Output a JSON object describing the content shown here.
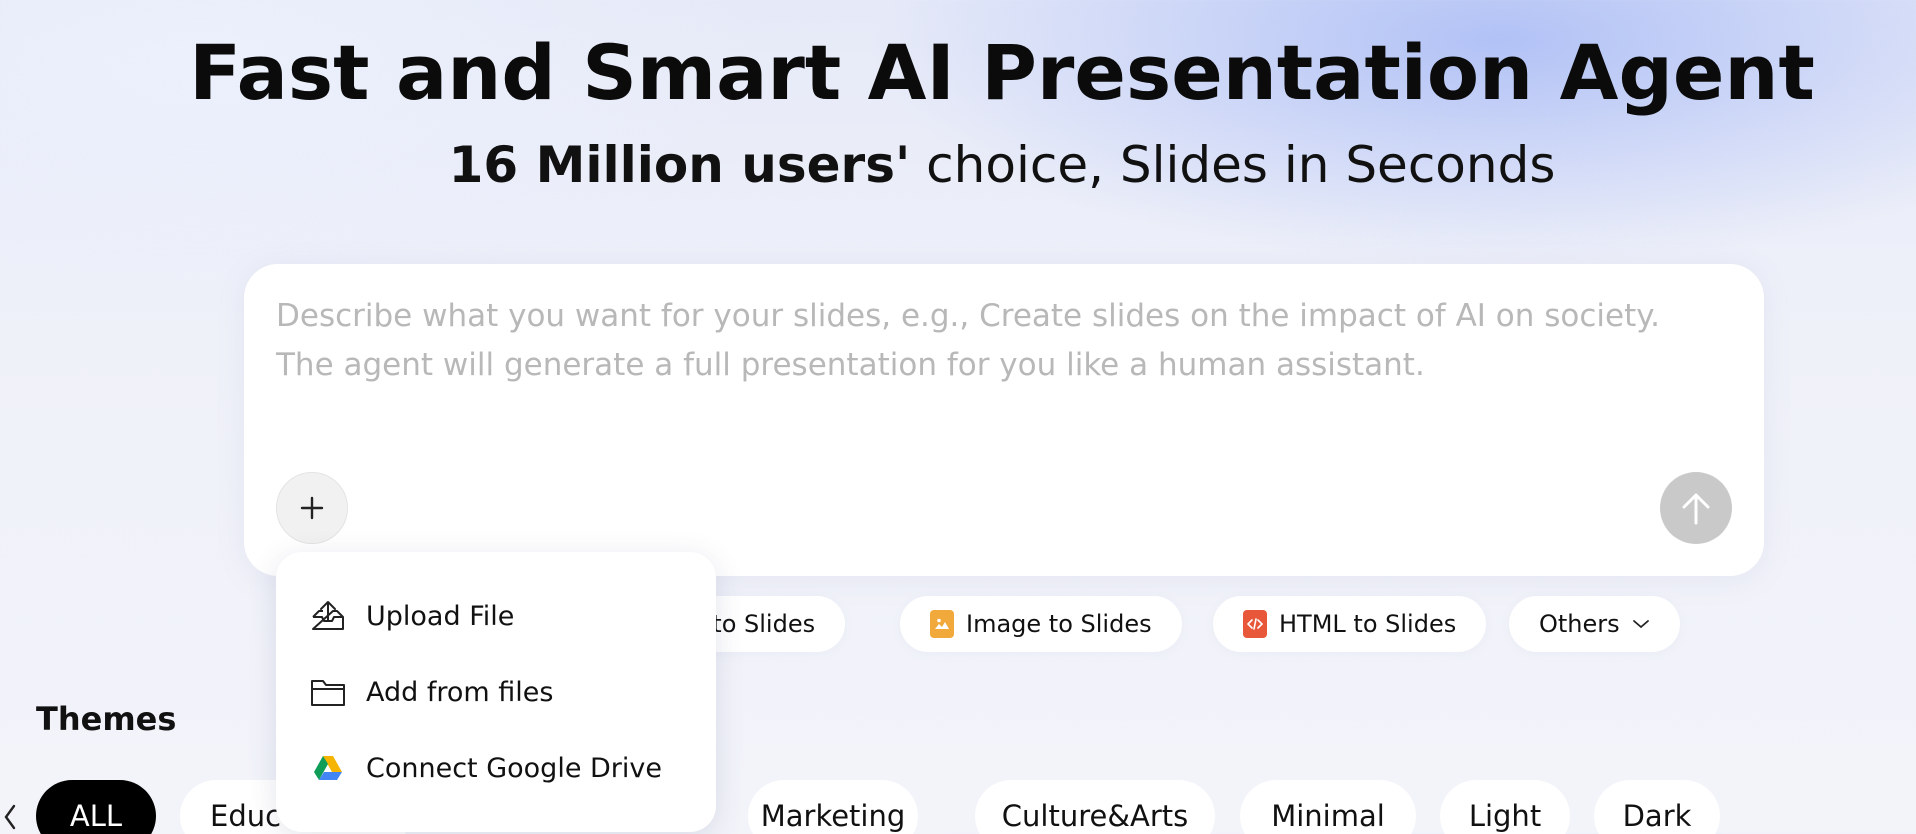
{
  "hero": {
    "title": "Fast and Smart AI Presentation Agent",
    "subtitle_bold": "16 Million users'",
    "subtitle_rest": " choice, Slides in Seconds"
  },
  "prompt": {
    "placeholder": "Describe what you want for your slides, e.g., Create slides on the impact of AI on society. The agent will generate a full presentation for you like a human assistant.",
    "value": ""
  },
  "modes": [
    {
      "label": "rd to Slides",
      "icon": "word-file-icon"
    },
    {
      "label": "Image to Slides",
      "icon": "image-file-icon",
      "color": "#F2A93B"
    },
    {
      "label": "HTML to Slides",
      "icon": "code-file-icon",
      "color": "#E8573A"
    },
    {
      "label": "Others",
      "icon": "chevron-down-icon"
    }
  ],
  "themes": {
    "title": "Themes",
    "items": [
      "ALL",
      "Educ",
      "Marketing",
      "Culture&Arts",
      "Minimal",
      "Light",
      "Dark"
    ],
    "active": "ALL"
  },
  "upload_menu": {
    "items": [
      {
        "label": "Upload File",
        "icon": "upload-tray-icon"
      },
      {
        "label": "Add from files",
        "icon": "folder-icon"
      },
      {
        "label": "Connect Google Drive",
        "icon": "google-drive-icon"
      }
    ]
  },
  "colors": {
    "send_button_disabled": "#C9C9C9",
    "theme_active_bg": "#000000",
    "placeholder_text": "#B8B8B8"
  }
}
